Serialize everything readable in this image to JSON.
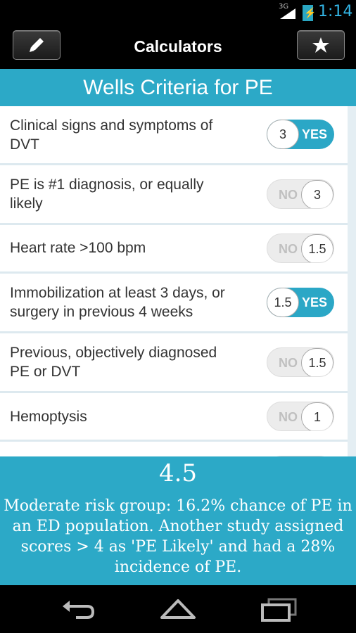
{
  "status_bar": {
    "network": "3G",
    "time": "1:14"
  },
  "action_bar": {
    "title": "Calculators",
    "left_icon": "pencil-icon",
    "right_icon": "star-icon"
  },
  "calculator": {
    "title": "Wells Criteria for PE"
  },
  "criteria": [
    {
      "label": "Clinical signs and symptoms of DVT",
      "points": "3",
      "state": "on",
      "state_label": "YES"
    },
    {
      "label": "PE is #1 diagnosis, or equally likely",
      "points": "3",
      "state": "off",
      "state_label": "NO"
    },
    {
      "label": "Heart rate >100 bpm",
      "points": "1.5",
      "state": "off",
      "state_label": "NO"
    },
    {
      "label": "Immobilization at least 3 days, or surgery in previous 4 weeks",
      "points": "1.5",
      "state": "on",
      "state_label": "YES"
    },
    {
      "label": "Previous, objectively diagnosed PE or DVT",
      "points": "1.5",
      "state": "off",
      "state_label": "NO"
    },
    {
      "label": "Hemoptysis",
      "points": "1",
      "state": "off",
      "state_label": "NO"
    }
  ],
  "result": {
    "score": "4.5",
    "description": "Moderate risk group: 16.2% chance of PE in an ED population. Another study assigned scores > 4 as 'PE Likely' and had a 28% incidence of PE."
  },
  "nav_bar": {
    "icons": [
      "back-icon",
      "home-icon",
      "recent-apps-icon"
    ]
  },
  "colors": {
    "accent": "#2ca9c7",
    "list_background": "#dde9ef",
    "status_time": "#33b5e5"
  }
}
